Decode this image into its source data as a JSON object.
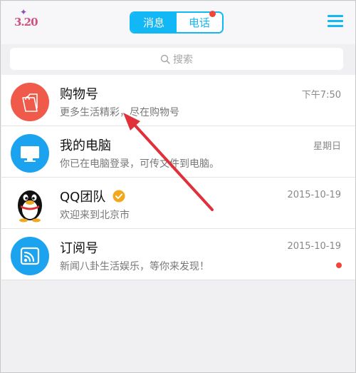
{
  "header": {
    "logo_text": "3.20",
    "tabs": [
      {
        "label": "消息",
        "active": true
      },
      {
        "label": "电话",
        "active": false,
        "badge": true
      }
    ]
  },
  "search": {
    "placeholder": "搜索"
  },
  "conversations": [
    {
      "name": "购物号",
      "preview": "更多生活精彩，尽在购物号",
      "time": "下午7:50",
      "unread_dot": false,
      "avatar_color": "#ef5a4a",
      "avatar_icon": "shopping-bag-icon"
    },
    {
      "name": "我的电脑",
      "preview": "你已在电脑登录，可传文件到电脑。",
      "time": "星期日",
      "unread_dot": false,
      "avatar_color": "#1ba3f0",
      "avatar_icon": "monitor-icon"
    },
    {
      "name": "QQ团队",
      "preview": "欢迎来到北京市",
      "time": "2015-10-19",
      "unread_dot": false,
      "avatar_color": "#ffffff",
      "avatar_icon": "penguin-icon",
      "verified": true
    },
    {
      "name": "订阅号",
      "preview": "新闻八卦生活娱乐，等你来发现！",
      "time": "2015-10-19",
      "unread_dot": true,
      "avatar_color": "#1ba3f0",
      "avatar_icon": "subscription-icon"
    }
  ],
  "colors": {
    "accent": "#12b7f5",
    "badge": "#f0473a",
    "annotation_arrow": "#e0303a"
  }
}
